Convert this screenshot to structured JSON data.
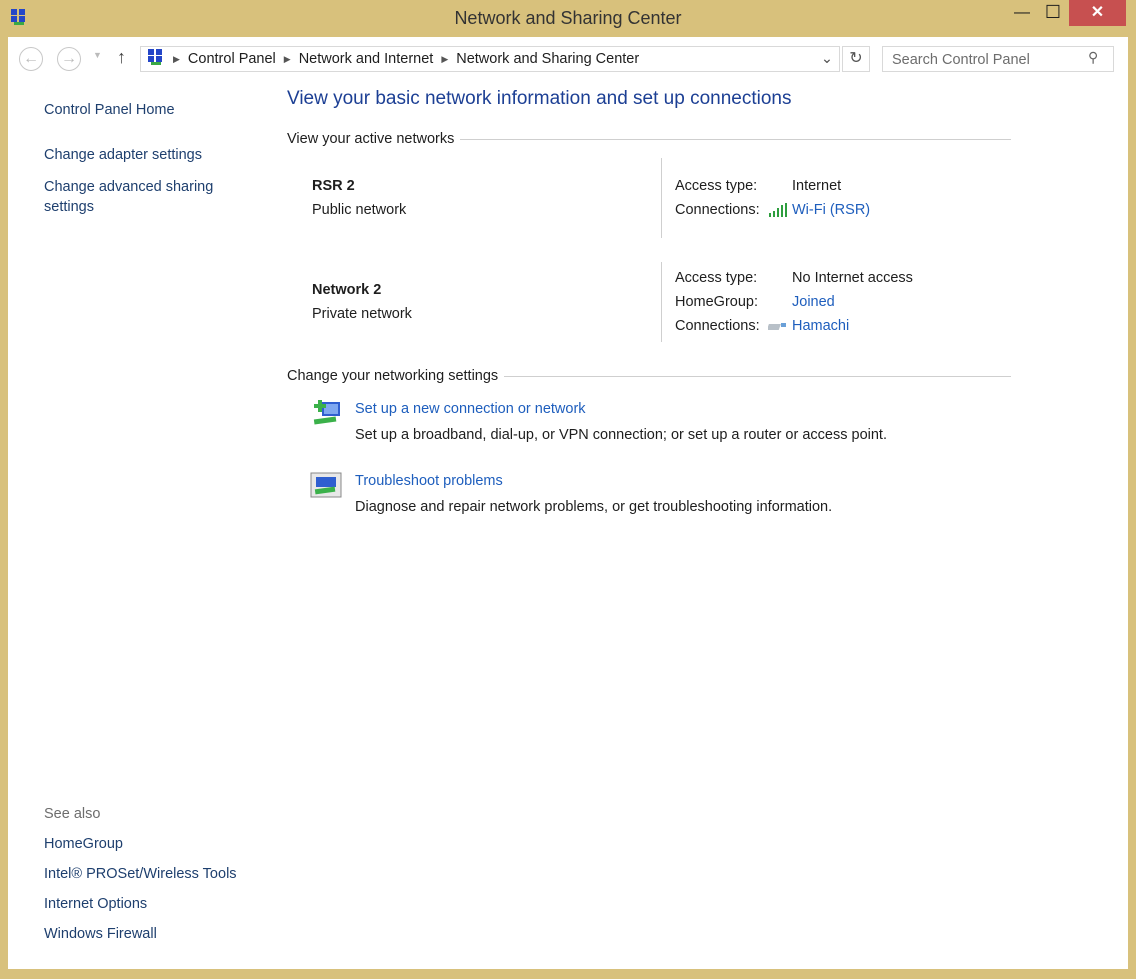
{
  "window": {
    "title": "Network and Sharing Center",
    "min": "—",
    "max": "☐",
    "close": "✕"
  },
  "nav": {
    "back": "←",
    "forward": "→",
    "up": "↑",
    "refresh": "↻",
    "dropdown": "⌄",
    "breadcrumb": [
      "Control Panel",
      "Network and Internet",
      "Network and Sharing Center"
    ],
    "search_placeholder": "Search Control Panel"
  },
  "sidebar": {
    "home": "Control Panel Home",
    "links": [
      "Change adapter settings",
      "Change advanced sharing settings"
    ],
    "see_also_title": "See also",
    "see_also": [
      "HomeGroup",
      "Intel® PROSet/Wireless Tools",
      "Internet Options",
      "Windows Firewall"
    ]
  },
  "main": {
    "heading": "View your basic network information and set up connections",
    "active_title": "View your active networks",
    "networks": [
      {
        "name": "RSR  2",
        "type": "Public network",
        "access_label": "Access type:",
        "access": "Internet",
        "conn_label": "Connections:",
        "conn": "Wi-Fi (RSR)"
      },
      {
        "name": "Network  2",
        "type": "Private network",
        "access_label": "Access type:",
        "access": "No Internet access",
        "hg_label": "HomeGroup:",
        "hg": "Joined",
        "conn_label": "Connections:",
        "conn": "Hamachi"
      }
    ],
    "settings_title": "Change your networking settings",
    "tasks": [
      {
        "title": "Set up a new connection or network",
        "desc": "Set up a broadband, dial-up, or VPN connection; or set up a router or access point."
      },
      {
        "title": "Troubleshoot problems",
        "desc": "Diagnose and repair network problems, or get troubleshooting information."
      }
    ]
  }
}
